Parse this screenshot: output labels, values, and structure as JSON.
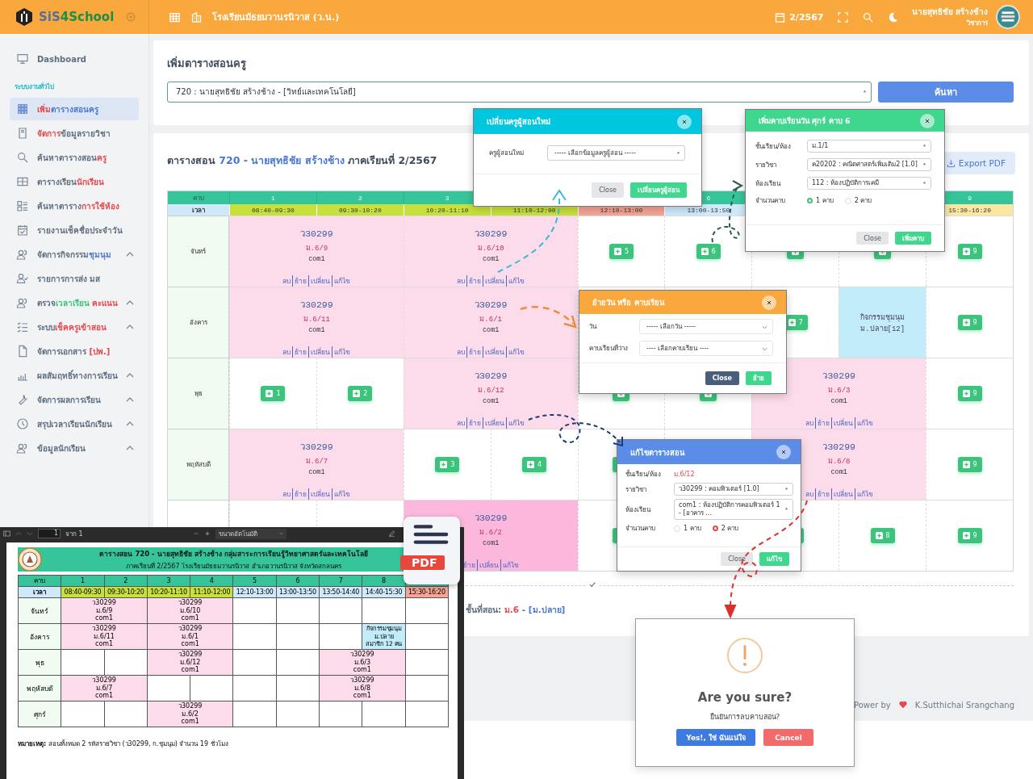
{
  "header": {
    "logo": [
      {
        "text": "SiS",
        "color": "#5a6f96"
      },
      {
        "text": "4School",
        "color": "#1e8f45"
      }
    ],
    "school": "โรงเรียนมัธยมวานรนิวาส (ว.น.)",
    "term": "2/2567",
    "user": {
      "name": "นายสุทธิชัย สร้างช้าง",
      "role": "วิชาการ"
    }
  },
  "sidebar": {
    "items": [
      {
        "kind": "link",
        "parts": [
          {
            "text": "Dashboard",
            "color": "#5f6f80"
          }
        ],
        "selected": false,
        "expandable": false
      },
      {
        "kind": "section",
        "parts": [
          {
            "text": "ระบบงานทั่วไป",
            "color": "#1bb8c8"
          }
        ]
      },
      {
        "kind": "link",
        "parts": [
          {
            "text": "เพิ่ม",
            "color": "#e8474c"
          },
          {
            "text": "ตารางสอนครู",
            "color": "#4a78d0"
          }
        ],
        "selected": true,
        "expandable": false
      },
      {
        "kind": "link",
        "parts": [
          {
            "text": "จัดการ",
            "color": "#e8474c"
          },
          {
            "text": "ข้อมูลรายวิชา",
            "color": "#5f6f80"
          }
        ],
        "selected": false,
        "expandable": false
      },
      {
        "kind": "link",
        "parts": [
          {
            "text": "ค้นหาตารางสอน",
            "color": "#5f6f80"
          },
          {
            "text": "ครู",
            "color": "#e8474c"
          }
        ],
        "selected": false,
        "expandable": false
      },
      {
        "kind": "link",
        "parts": [
          {
            "text": "ตารางเรียน",
            "color": "#5f6f80"
          },
          {
            "text": "นักเรียน",
            "color": "#e8474c"
          }
        ],
        "selected": false,
        "expandable": false
      },
      {
        "kind": "link",
        "parts": [
          {
            "text": "ค้นหาตาราง",
            "color": "#5f6f80"
          },
          {
            "text": "การใช้ห้อง",
            "color": "#e8474c"
          }
        ],
        "selected": false,
        "expandable": false
      },
      {
        "kind": "link",
        "parts": [
          {
            "text": "รายงานเช็คชื่อประจำวัน",
            "color": "#5f6f80"
          }
        ],
        "selected": false,
        "expandable": false
      },
      {
        "kind": "link",
        "parts": [
          {
            "text": "จัดการกิจกรรม",
            "color": "#5f6f80"
          },
          {
            "text": "ชุมนุม",
            "color": "#4a78d0"
          }
        ],
        "selected": false,
        "expandable": true
      },
      {
        "kind": "link",
        "parts": [
          {
            "text": "รายการการส่ง มส",
            "color": "#5f6f80"
          }
        ],
        "selected": false,
        "expandable": false
      },
      {
        "kind": "link",
        "parts": [
          {
            "text": "ตรวจ",
            "color": "#5f6f80"
          },
          {
            "text": "เวลาเรียน",
            "color": "#3cc47c"
          },
          {
            "text": " คะแนน",
            "color": "#e8474c"
          }
        ],
        "selected": false,
        "expandable": true
      },
      {
        "kind": "link",
        "parts": [
          {
            "text": "ระบบ",
            "color": "#5f6f80"
          },
          {
            "text": "เช็คครูเข้าสอน",
            "color": "#e8474c"
          }
        ],
        "selected": false,
        "expandable": true
      },
      {
        "kind": "link",
        "parts": [
          {
            "text": "จัดการเอกสาร ",
            "color": "#5f6f80"
          },
          {
            "text": "[ปพ.]",
            "color": "#e8474c"
          }
        ],
        "selected": false,
        "expandable": false
      },
      {
        "kind": "link",
        "parts": [
          {
            "text": "ผลสัมฤทธิ์ทางการเรียน",
            "color": "#5f6f80"
          }
        ],
        "selected": false,
        "expandable": true
      },
      {
        "kind": "link",
        "parts": [
          {
            "text": "จัดการผลการเรียน",
            "color": "#5f6f80"
          }
        ],
        "selected": false,
        "expandable": true
      },
      {
        "kind": "link",
        "parts": [
          {
            "text": "สรุปเวลาเรียนนักเรียน",
            "color": "#5f6f80"
          }
        ],
        "selected": false,
        "expandable": true
      },
      {
        "kind": "link",
        "parts": [
          {
            "text": "ข้อมูลนักเรียน",
            "color": "#5f6f80"
          }
        ],
        "selected": false,
        "expandable": true
      }
    ]
  },
  "search_card": {
    "title": "เพิ่มตารางสอนครู",
    "teacher_select": "720 : นายสุทธิชัย สร้างช้าง - [วิทย์และเทคโนโลยี]",
    "button": "ค้นหา"
  },
  "schedule": {
    "title_parts": [
      {
        "text": "ตารางสอน ",
        "color": "#3e4c5c"
      },
      {
        "text": "720 - นายสุทธิชัย สร้างช้าง",
        "color": "#4a78d0"
      },
      {
        "text": " ภาคเรียนที่ 2/2567",
        "color": "#3e4c5c"
      }
    ],
    "export_button": "Export PDF",
    "table": {
      "period_header": "คาบ",
      "time_header": "เวลา",
      "periods": [
        {
          "kind": "period",
          "number": "1",
          "time": "08:40-09:30",
          "color": "#c8e03c"
        },
        {
          "kind": "period",
          "number": "2",
          "time": "09:30-10:20",
          "color": "#c8e03c"
        },
        {
          "kind": "period",
          "number": "3",
          "time": "10:20-11:10",
          "color": "#c8e03c"
        },
        {
          "kind": "period",
          "time": "11:10-12:00",
          "color": "#c8e03c"
        },
        {
          "kind": "period",
          "time": "12:10-13:00",
          "color": "#f6a596"
        },
        {
          "kind": "period",
          "number": "6",
          "time": "13:00-13:50",
          "color": "#cfe9fb"
        },
        {
          "kind": "empty"
        },
        {
          "kind": "empty"
        },
        {
          "kind": "period",
          "number": "9",
          "time": "15:30-16:20",
          "color": "#fbe6a2"
        }
      ],
      "rows": [
        {
          "day": "จันทร์",
          "cells": [
            {
              "kind": "lesson",
              "code": "ว30299",
              "class": "ม.6/9",
              "room": "com1",
              "actions": [
                "ลบ",
                "ย้าย",
                "เปลี่ยน",
                "แก้ไข"
              ],
              "highlighted": false
            },
            {
              "kind": "lesson",
              "code": "ว30299",
              "class": "ม.6/10",
              "room": "com1",
              "actions": [
                "ลบ",
                "ย้าย",
                "เปลี่ยน",
                "แก้ไข"
              ],
              "highlighted": false
            },
            {
              "kind": "add",
              "label": "5"
            },
            {
              "kind": "add",
              "label": "6"
            },
            {
              "kind": "add"
            },
            {
              "kind": "add"
            },
            {
              "kind": "add",
              "label": "9"
            }
          ]
        },
        {
          "day": "อังคาร",
          "cells": [
            {
              "kind": "lesson",
              "code": "ว30299",
              "class": "ม.6/11",
              "room": "com1",
              "actions": [
                "ลบ",
                "ย้าย",
                "เปลี่ยน",
                "แก้ไข"
              ],
              "highlighted": false
            },
            {
              "kind": "lesson",
              "code": "ว30299",
              "class": "ม.6/1",
              "room": "com1",
              "actions": [
                "ลบ",
                "ย้าย",
                "เปลี่ยน",
                "แก้ไข"
              ],
              "highlighted": false
            },
            {
              "kind": "empty"
            },
            {
              "kind": "empty"
            },
            {
              "kind": "add",
              "label": "7"
            },
            {
              "kind": "activity",
              "lines": [
                "กิจกรรมชุมนุม",
                "ม.ปลาย[12]"
              ]
            },
            {
              "kind": "add",
              "label": "9"
            }
          ]
        },
        {
          "day": "พุธ",
          "cells": [
            {
              "kind": "add",
              "label": "1"
            },
            {
              "kind": "add",
              "label": "2"
            },
            {
              "kind": "lesson",
              "code": "ว30299",
              "class": "ม.6/12",
              "room": "com1",
              "actions": [
                "ลบ",
                "ย้าย",
                "เปลี่ยน",
                "แก้ไข"
              ],
              "highlighted": false
            },
            {
              "kind": "add"
            },
            {
              "kind": "add"
            },
            {
              "kind": "lesson",
              "code": "ว30299",
              "class": "ม.6/3",
              "room": "com1",
              "actions": [
                "ลบ",
                "ย้าย",
                "เปลี่ยน",
                "แก้ไข"
              ],
              "highlighted": false
            },
            {
              "kind": "add",
              "label": "9"
            }
          ]
        },
        {
          "day": "พฤหัสบดี",
          "cells": [
            {
              "kind": "lesson",
              "code": "ว30299",
              "class": "ม.6/7",
              "room": "com1",
              "actions": [
                "ลบ",
                "ย้าย",
                "เปลี่ยน",
                "แก้ไข"
              ],
              "highlighted": false
            },
            {
              "kind": "add",
              "label": "3"
            },
            {
              "kind": "add",
              "label": "4"
            },
            {
              "kind": "add"
            },
            {
              "kind": "empty"
            },
            {
              "kind": "lesson",
              "code": "ว30299",
              "class": "ม.6/8",
              "room": "com1",
              "actions": [
                "ลบ",
                "ย้าย",
                "เปลี่ยน",
                "แก้ไข"
              ],
              "highlighted": false
            },
            {
              "kind": "add",
              "label": "9"
            }
          ]
        },
        {
          "cells": [
            {
              "kind": "empty"
            },
            {
              "kind": "empty"
            },
            {
              "kind": "lesson",
              "code": "ว30299",
              "class": "ม.6/2",
              "room": "com1",
              "actions": [
                "ย้าย",
                "เปลี่ยน",
                "แก้ไข"
              ],
              "highlighted": true
            },
            {
              "kind": "add"
            },
            {
              "kind": "covered"
            },
            {
              "kind": "add"
            },
            {
              "kind": "add",
              "label": "8"
            },
            {
              "kind": "add",
              "label": "9"
            }
          ]
        }
      ]
    },
    "level_parts": [
      {
        "text": "ชั้นที่สอน: ",
        "color": "#5f6f80"
      },
      {
        "text": "ม.6",
        "color": "#e8474c"
      },
      {
        "text": " - "
      },
      {
        "text": "[ม.ปลาย]",
        "color": "#4a78d0"
      }
    ]
  },
  "footer": {
    "power": "Power by",
    "author": "K.Sutthichai Srangchang"
  },
  "change_teacher_modal": {
    "title": "เปลี่ยนครูผู้สอนใหม่",
    "label": "ครูผู้สอนใหม่",
    "select": "----- เลือกข้อมูลครูผู้สอน -----",
    "close": "Close",
    "submit": "เปลี่ยนครูผู้สอน"
  },
  "add_period_modal": {
    "title": "เพิ่มคาบเรียนวัน ศุกร์ คาบ 6",
    "fields": [
      {
        "label": "ชั้นเรียน/ห้อง",
        "value": "ม.1/1"
      },
      {
        "label": "รายวิชา",
        "value": "ค20202 : คณิตศาสตร์เพิ่มเติม2 [1.0]"
      },
      {
        "label": "ห้องเรียน",
        "value": "112 : ห้องปฏิบัติการเคมี"
      }
    ],
    "count_label": "จำนวนคาบ",
    "options": [
      {
        "label": "1 คาบ",
        "selected": true
      },
      {
        "label": "2 คาบ",
        "selected": false
      }
    ],
    "close": "Close",
    "submit": "เพิ่มคาบ"
  },
  "move_modal": {
    "title": "ย้ายวัน หรือ คาบเรียน",
    "fields": [
      {
        "label": "วัน",
        "value": "----- เลือกวัน -----"
      },
      {
        "label": "คาบเรียนที่ว่าง",
        "value": "---- เลือกคาบเรียน ----"
      }
    ],
    "close": "Close",
    "submit": "ย้าย"
  },
  "edit_modal": {
    "title": "แก้ไขตารางสอน",
    "class_label": "ชั้นเรียน/ห้อง",
    "class_value": "ม.6/12",
    "fields": [
      {
        "label": "รายวิชา",
        "value": "ว30299 : คอมพิวเตอร์ [1.0]"
      },
      {
        "label": "ห้องเรียน",
        "value": "com1 : ห้องปฏิบัติการคอมพิวเตอร์ 1 - [อาคาร ..."
      }
    ],
    "count_label": "จำนวนคาบ",
    "options": [
      {
        "label": "1 คาบ",
        "selected": false
      },
      {
        "label": "2 คาบ",
        "selected": true
      }
    ],
    "close": "Close",
    "submit": "แก้ไข"
  },
  "confirm_dialog": {
    "title": "Are you sure?",
    "message": "ยืนยันการลบคาบสอน?",
    "confirm": "Yes!, ใช่ ฉันแน่ใจ",
    "cancel": "Cancel"
  },
  "pdf_viewer": {
    "page_input": "1",
    "page_total": "จาก 1",
    "zoom": "ขนาดอัตโนมัติ",
    "badge": "PDF",
    "title": "ตารางสอน 720 - นายสุทธิชัย สร้างช้าง กลุ่มสาระการเรียนรู้วิทยาศาสตร์และเทคโนโลยี",
    "subtitle": "ภาคเรียนที่ 2/2567 โรงเรียนมัธยมวานรนิวาส อำเภอวานรนิวาส จังหวัดสกลนคร",
    "table": {
      "period_header": "คาบ",
      "time_header": "เวลา",
      "periods": [
        {
          "number": "1",
          "time": "08:40-09:30",
          "color": "#c8e03c"
        },
        {
          "number": "2",
          "time": "09:30-10:20",
          "color": "#c8e03c"
        },
        {
          "number": "3",
          "time": "10:20-11:10",
          "color": "#c8e03c"
        },
        {
          "number": "4",
          "time": "11:10-12:00",
          "color": "#c8e03c"
        },
        {
          "number": "5",
          "time": "12:10-13:00",
          "color": "#cfe9fb"
        },
        {
          "number": "6",
          "time": "13:00-13:50",
          "color": "#cfe9fb"
        },
        {
          "number": "7",
          "time": "13:50-14:40",
          "color": "#cfe9fb"
        },
        {
          "number": "8",
          "time": "14:40-15:30",
          "color": "#cfe9fb"
        },
        {
          "time": "15:30-16:20",
          "color": "#f6a596"
        }
      ],
      "rows": [
        {
          "day": "จันทร์",
          "cells": [
            {
              "kind": "lesson",
              "lines": [
                "ว30299",
                "ม.6/9",
                "com1"
              ]
            },
            {
              "kind": "lesson",
              "lines": [
                "ว30299",
                "ม.6/10",
                "com1"
              ]
            },
            {
              "kind": "blank"
            },
            {
              "kind": "blank"
            },
            {
              "kind": "blank"
            },
            {
              "kind": "blank"
            },
            {
              "kind": "blank"
            }
          ]
        },
        {
          "day": "อังคาร",
          "cells": [
            {
              "kind": "lesson",
              "lines": [
                "ว30299",
                "ม.6/11",
                "com1"
              ]
            },
            {
              "kind": "lesson",
              "lines": [
                "ว30299",
                "ม.6/1",
                "com1"
              ]
            },
            {
              "kind": "blank"
            },
            {
              "kind": "blank"
            },
            {
              "kind": "blank"
            },
            {
              "kind": "activity",
              "lines": [
                "กิจกรรมชุมนุม",
                "ม.ปลาย",
                "สมาชิก 12 คน"
              ]
            },
            {
              "kind": "blank"
            }
          ]
        },
        {
          "day": "พุธ",
          "cells": [
            {
              "kind": "blank"
            },
            {
              "kind": "blank"
            },
            {
              "kind": "lesson",
              "lines": [
                "ว30299",
                "ม.6/12",
                "com1"
              ]
            },
            {
              "kind": "blank"
            },
            {
              "kind": "blank"
            },
            {
              "kind": "lesson",
              "lines": [
                "ว30299",
                "ม.6/3",
                "com1"
              ]
            },
            {
              "kind": "blank"
            }
          ]
        },
        {
          "day": "พฤหัสบดี",
          "cells": [
            {
              "kind": "lesson",
              "lines": [
                "ว30299",
                "ม.6/7",
                "com1"
              ]
            },
            {
              "kind": "blank"
            },
            {
              "kind": "blank"
            },
            {
              "kind": "blank"
            },
            {
              "kind": "blank"
            },
            {
              "kind": "lesson",
              "lines": [
                "ว30299",
                "ม.6/8",
                "com1"
              ]
            },
            {
              "kind": "blank"
            }
          ]
        },
        {
          "day": "ศุกร์",
          "cells": [
            {
              "kind": "blank"
            },
            {
              "kind": "blank"
            },
            {
              "kind": "lesson",
              "lines": [
                "ว30299",
                "ม.6/2",
                "com1"
              ]
            },
            {
              "kind": "blank"
            },
            {
              "kind": "blank"
            },
            {
              "kind": "blank"
            },
            {
              "kind": "blank"
            },
            {
              "kind": "blank"
            }
          ]
        }
      ]
    },
    "note": "**หมายเหตุ:** สอนทั้งหมด 2 รหัสรายวิชา (ว30299, ก.ชุมนุม) จำนวน 19 ชั่วโมง"
  }
}
